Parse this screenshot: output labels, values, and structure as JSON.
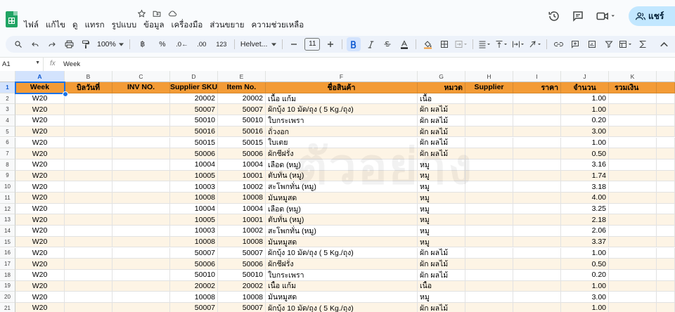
{
  "menu": [
    "ไฟล์",
    "แก้ไข",
    "ดู",
    "แทรก",
    "รูปแบบ",
    "ข้อมูล",
    "เครื่องมือ",
    "ส่วนขยาย",
    "ความช่วยเหลือ"
  ],
  "share_label": "แชร์",
  "toolbar": {
    "zoom": "100%",
    "currency": "฿",
    "percent": "%",
    "dec_decrease": ".0←",
    "dec_increase": ".00",
    "number_format": "123",
    "font_name": "Helvet...",
    "font_size": "11"
  },
  "formula_bar": {
    "cell_ref": "A1",
    "value": "Week"
  },
  "watermark": "ตัวอย่าง",
  "columns": [
    "A",
    "B",
    "C",
    "D",
    "E",
    "F",
    "G",
    "H",
    "I",
    "J",
    "K"
  ],
  "headers": [
    "Week",
    "บิลวันที่",
    "INV NO.",
    "Supplier SKU",
    "Item No.",
    "ชื่อสินค้า",
    "หมวด",
    "Supplier",
    "ราคา",
    "จำนวน",
    "รวมเงิน"
  ],
  "rows": [
    {
      "n": "2",
      "week": "W20",
      "sku": "20002",
      "item": "20002",
      "name": "เนื้อ แก้ม",
      "cat": "เนื้อ",
      "qty": "1.00"
    },
    {
      "n": "3",
      "week": "W20",
      "sku": "50007",
      "item": "50007",
      "name": "ผักบุ้ง 10 มัด/ถุง ( 5 Kg./ถุง)",
      "cat": "ผัก ผลไม้",
      "qty": "1.00"
    },
    {
      "n": "4",
      "week": "W20",
      "sku": "50010",
      "item": "50010",
      "name": "ใบกระเพรา",
      "cat": "ผัก ผลไม้",
      "qty": "0.20"
    },
    {
      "n": "5",
      "week": "W20",
      "sku": "50016",
      "item": "50016",
      "name": "ถั่วงอก",
      "cat": "ผัก ผลไม้",
      "qty": "3.00"
    },
    {
      "n": "6",
      "week": "W20",
      "sku": "50015",
      "item": "50015",
      "name": "ใบเตย",
      "cat": "ผัก ผลไม้",
      "qty": "1.00"
    },
    {
      "n": "7",
      "week": "W20",
      "sku": "50006",
      "item": "50006",
      "name": "ผักชีฝรั่ง",
      "cat": "ผัก ผลไม้",
      "qty": "0.50"
    },
    {
      "n": "8",
      "week": "W20",
      "sku": "10004",
      "item": "10004",
      "name": "เลือด (หมู)",
      "cat": "หมู",
      "qty": "3.16"
    },
    {
      "n": "9",
      "week": "W20",
      "sku": "10005",
      "item": "10001",
      "name": "ตับทั่น (หมู)",
      "cat": "หมู",
      "qty": "1.74"
    },
    {
      "n": "10",
      "week": "W20",
      "sku": "10003",
      "item": "10002",
      "name": "สะโพกทั่น (หมู)",
      "cat": "หมู",
      "qty": "3.18"
    },
    {
      "n": "11",
      "week": "W20",
      "sku": "10008",
      "item": "10008",
      "name": "มันหมูสด",
      "cat": "หมู",
      "qty": "4.00"
    },
    {
      "n": "12",
      "week": "W20",
      "sku": "10004",
      "item": "10004",
      "name": "เลือด (หมู)",
      "cat": "หมู",
      "qty": "3.25"
    },
    {
      "n": "13",
      "week": "W20",
      "sku": "10005",
      "item": "10001",
      "name": "ตับทั่น (หมู)",
      "cat": "หมู",
      "qty": "2.18"
    },
    {
      "n": "14",
      "week": "W20",
      "sku": "10003",
      "item": "10002",
      "name": "สะโพกทั่น (หมู)",
      "cat": "หมู",
      "qty": "2.06"
    },
    {
      "n": "15",
      "week": "W20",
      "sku": "10008",
      "item": "10008",
      "name": "มันหมูสด",
      "cat": "หมู",
      "qty": "3.37"
    },
    {
      "n": "16",
      "week": "W20",
      "sku": "50007",
      "item": "50007",
      "name": "ผักบุ้ง 10 มัด/ถุง ( 5 Kg./ถุง)",
      "cat": "ผัก ผลไม้",
      "qty": "1.00"
    },
    {
      "n": "17",
      "week": "W20",
      "sku": "50006",
      "item": "50006",
      "name": "ผักชีฝรั่ง",
      "cat": "ผัก ผลไม้",
      "qty": "0.50"
    },
    {
      "n": "18",
      "week": "W20",
      "sku": "50010",
      "item": "50010",
      "name": "ใบกระเพรา",
      "cat": "ผัก ผลไม้",
      "qty": "0.20"
    },
    {
      "n": "19",
      "week": "W20",
      "sku": "20002",
      "item": "20002",
      "name": "เนื้อ แก้ม",
      "cat": "เนื้อ",
      "qty": "1.00"
    },
    {
      "n": "20",
      "week": "W20",
      "sku": "10008",
      "item": "10008",
      "name": "มันหมูสด",
      "cat": "หมู",
      "qty": "3.00"
    },
    {
      "n": "21",
      "week": "W20",
      "sku": "50007",
      "item": "50007",
      "name": "ผักบุ้ง 10 มัด/ถุง ( 5 Kg./ถุง)",
      "cat": "ผัก ผลไม้",
      "qty": "1.00"
    }
  ],
  "colors": {
    "header_fill": "#f39b36",
    "band_fill": "#fdf4e5",
    "accent": "#1a73e8",
    "share_fill": "#c2e7ff"
  }
}
